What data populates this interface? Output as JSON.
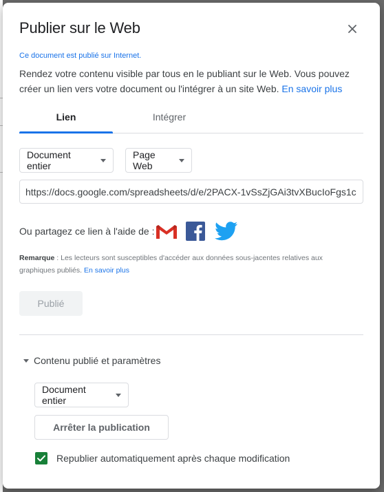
{
  "dialog": {
    "title": "Publier sur le Web",
    "status": "Ce document est publié sur Internet.",
    "description": "Rendez votre contenu visible par tous en le publiant sur le Web. Vous pouvez créer un lien vers votre document ou l'intégrer à un site Web.",
    "learn_more": "En savoir plus"
  },
  "tabs": [
    {
      "label": "Lien",
      "active": true
    },
    {
      "label": "Intégrer",
      "active": false
    }
  ],
  "link_options": {
    "scope_value": "Document entier",
    "format_value": "Page Web",
    "url": "https://docs.google.com/spreadsheets/d/e/2PACX-1vSsZjGAi3tvXBucIoFgs1c"
  },
  "share": {
    "label": "Ou partagez ce lien à l'aide de :",
    "icons": [
      "gmail-icon",
      "facebook-icon",
      "twitter-icon"
    ]
  },
  "remark": {
    "label": "Remarque",
    "text": " : Les lecteurs sont susceptibles d'accéder aux données sous-jacentes relatives aux graphiques publiés.",
    "learn_more": "En savoir plus"
  },
  "publish_button": "Publié",
  "published_section": {
    "toggle_label": "Contenu publié et paramètres",
    "scope_value": "Document entier",
    "stop_button": "Arrêter la publication",
    "auto_republish_label": "Republier automatiquement après chaque modification",
    "auto_republish_checked": true
  },
  "colors": {
    "accent": "#1a73e8",
    "checkbox": "#188038",
    "overlay": "#6b6b6b"
  }
}
